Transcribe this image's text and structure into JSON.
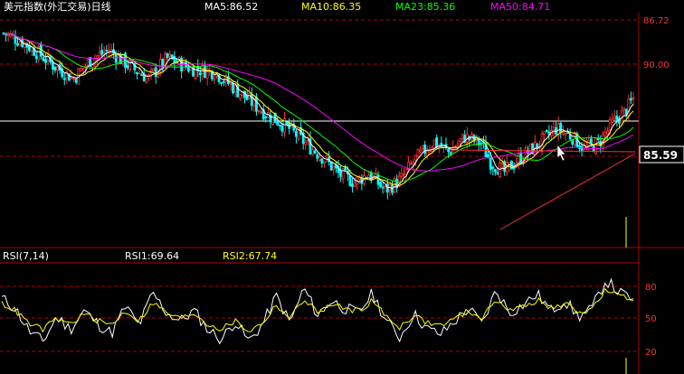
{
  "header": {
    "title": "美元指数(外汇交易)日线",
    "ma5": "MA5:86.52",
    "ma10": "MA10:86.35",
    "ma23": "MA23:85.36",
    "ma50": "MA50:84.71"
  },
  "rsi_header": {
    "title": "RSI(7,14)",
    "rsi1": "RSI1:69.64",
    "rsi2": "RSI2:67.74"
  },
  "price_axis": {
    "top_value": "86.72",
    "level_90": "90.00",
    "current": "85.59"
  },
  "rsi_axis": {
    "level_80": "80",
    "level_50": "50",
    "level_20": "20"
  },
  "colors": {
    "background": "#000000",
    "up_candle": "#ff3232",
    "down_candle": "#00ffff",
    "ma5": "#ffffff",
    "ma10": "#ffff00",
    "ma23": "#00ff00",
    "ma50": "#ff00ff",
    "rsi1": "#ffffff",
    "rsi2": "#ffff00",
    "grid": "#b00000"
  },
  "chart_data": [
    {
      "type": "candlestick",
      "title": "美元指数(外汇交易)日线",
      "ylim": [
        78.8,
        92.2
      ],
      "gridlines": [
        90.0,
        86.72
      ],
      "moving_averages": [
        {
          "name": "MA5",
          "value": 86.52
        },
        {
          "name": "MA10",
          "value": 86.35
        },
        {
          "name": "MA23",
          "value": 85.36
        },
        {
          "name": "MA50",
          "value": 84.71
        }
      ],
      "close_path": [
        [
          0,
          91.4
        ],
        [
          8,
          90.9
        ],
        [
          15,
          90.2
        ],
        [
          22,
          89.4
        ],
        [
          30,
          88.7
        ],
        [
          37,
          89.8
        ],
        [
          45,
          90.4
        ],
        [
          55,
          89.3
        ],
        [
          62,
          88.7
        ],
        [
          70,
          89.9
        ],
        [
          80,
          89.3
        ],
        [
          90,
          89.1
        ],
        [
          97,
          88.3
        ],
        [
          110,
          86.8
        ],
        [
          122,
          85.7
        ],
        [
          130,
          84.7
        ],
        [
          137,
          83.9
        ],
        [
          143,
          83.0
        ],
        [
          150,
          82.5
        ],
        [
          156,
          83.0
        ],
        [
          163,
          82.0
        ],
        [
          170,
          82.7
        ],
        [
          176,
          83.9
        ],
        [
          184,
          84.9
        ],
        [
          190,
          84.3
        ],
        [
          197,
          85.2
        ],
        [
          204,
          84.8
        ],
        [
          208,
          83.7
        ],
        [
          214,
          83.1
        ],
        [
          220,
          83.9
        ],
        [
          228,
          84.7
        ],
        [
          236,
          85.7
        ],
        [
          243,
          85.2
        ],
        [
          248,
          84.5
        ],
        [
          254,
          84.8
        ],
        [
          260,
          86.0
        ],
        [
          266,
          86.8
        ],
        [
          269,
          87.5
        ]
      ]
    },
    {
      "type": "line",
      "title": "RSI(7,14)",
      "ylim": [
        0,
        100
      ],
      "gridlines": [
        80,
        50,
        20
      ],
      "series": [
        {
          "name": "RSI1",
          "last": 69.64,
          "values": [
            70,
            60,
            38,
            28,
            52,
            40,
            58,
            45,
            36,
            62,
            44,
            75,
            56,
            48,
            58,
            40,
            30,
            48,
            28,
            45,
            72,
            46,
            80,
            54,
            68,
            60,
            56,
            75,
            48,
            32,
            55,
            40,
            35,
            48,
            60,
            45,
            78,
            56,
            64,
            74,
            58,
            68,
            52,
            60,
            88,
            75,
            69.64
          ]
        },
        {
          "name": "RSI2",
          "last": 67.74,
          "values": [
            65,
            58,
            45,
            40,
            50,
            45,
            55,
            48,
            44,
            58,
            48,
            66,
            56,
            50,
            56,
            45,
            40,
            48,
            38,
            46,
            64,
            50,
            70,
            56,
            64,
            60,
            58,
            68,
            52,
            42,
            54,
            46,
            44,
            50,
            58,
            50,
            70,
            58,
            62,
            68,
            60,
            65,
            56,
            60,
            78,
            72,
            67.74
          ]
        }
      ]
    }
  ]
}
